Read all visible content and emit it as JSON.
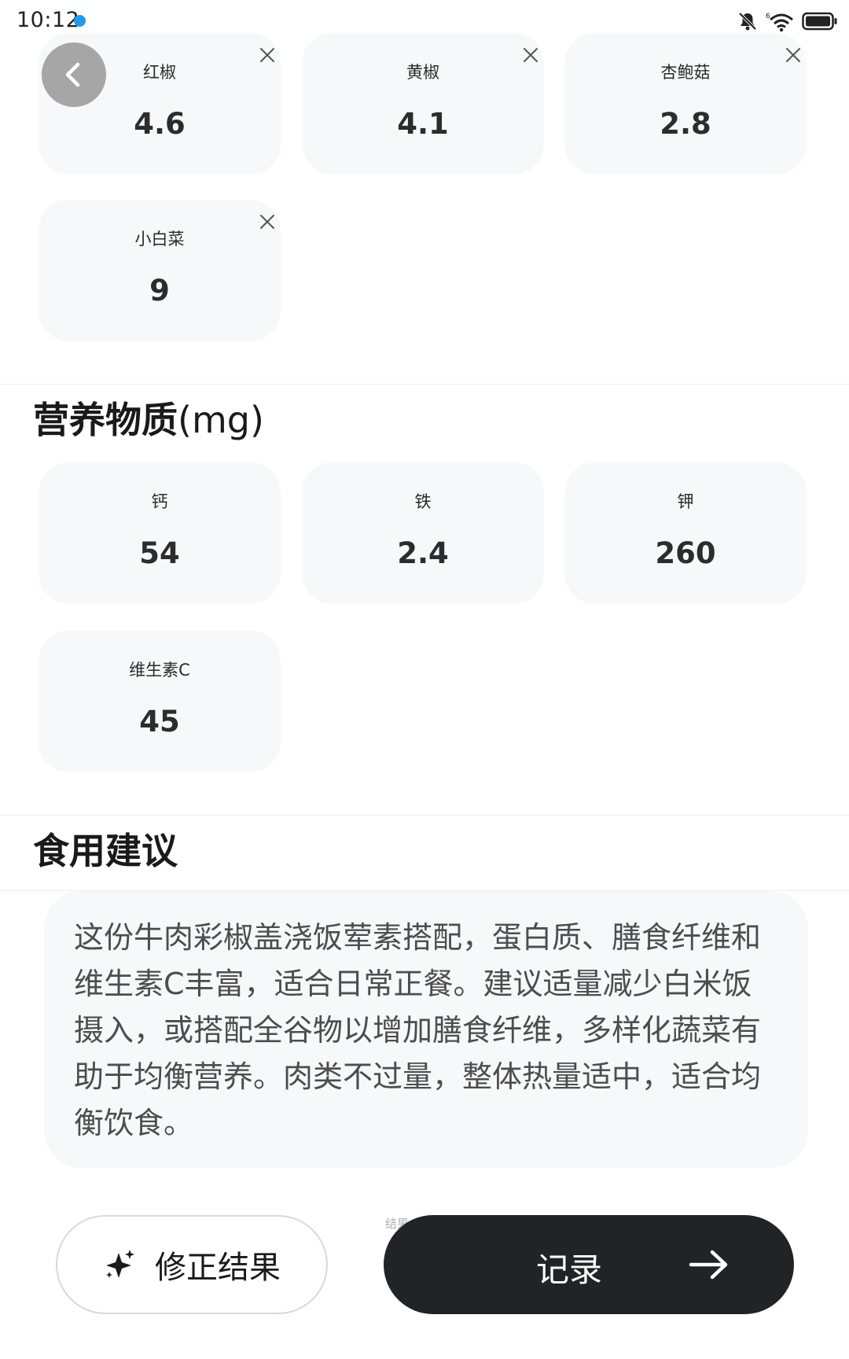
{
  "status_bar": {
    "time": "10:12"
  },
  "vegetable_cards": [
    {
      "name": "红椒",
      "value": "4.6"
    },
    {
      "name": "黄椒",
      "value": "4.1"
    },
    {
      "name": "杏鲍菇",
      "value": "2.8"
    },
    {
      "name": "小白菜",
      "value": "9"
    }
  ],
  "nutrients_section": {
    "title": "营养物质",
    "unit": "(mg)",
    "items": [
      {
        "name": "钙",
        "value": "54"
      },
      {
        "name": "铁",
        "value": "2.4"
      },
      {
        "name": "钾",
        "value": "260"
      },
      {
        "name": "维生素C",
        "value": "45"
      }
    ]
  },
  "advice_section": {
    "title": "食用建议",
    "text": "这份牛肉彩椒盖浇饭荤素搭配，蛋白质、膳食纤维和维生素C丰富，适合日常正餐。建议适量减少白米饭摄入，或搭配全谷物以增加膳食纤维，多样化蔬菜有助于均衡营养。肉类不过量，整体热量适中，适合均衡饮食。"
  },
  "actions": {
    "fix_label": "修正结果",
    "ghost_label": "结果",
    "record_label": "记录"
  },
  "colors": {
    "card_bg": "#f7f8fa",
    "primary_button": "#222326",
    "back_button": "#a6a6a6",
    "status_dot": "#1e9bf0"
  },
  "icons": [
    "back-arrow-icon",
    "close-icon",
    "sparkle-icon",
    "arrow-right-icon",
    "bell-muted-icon",
    "wifi-icon",
    "battery-icon"
  ]
}
